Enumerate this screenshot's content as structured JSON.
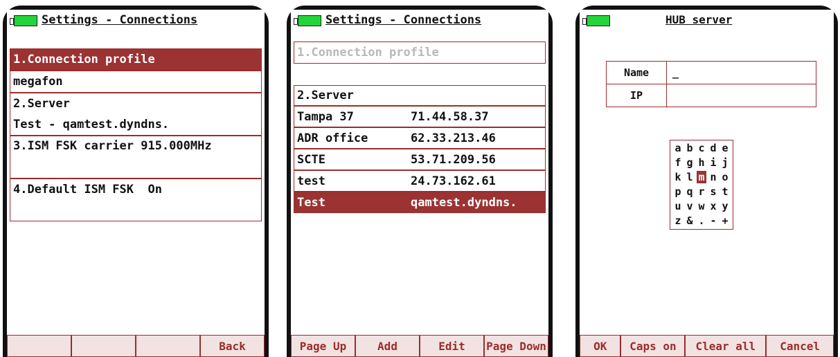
{
  "screens": [
    {
      "title": "Settings - Connections",
      "rows": [
        "1.Connection profile",
        "megafon",
        "2.Server",
        "Test - qamtest.dyndns.",
        "3.ISM FSK carrier 915.000MHz",
        "4.Default ISM FSK  On"
      ],
      "footer": [
        "",
        "",
        "",
        "Back"
      ]
    },
    {
      "title": "Settings - Connections",
      "header_row": "1.Connection profile",
      "server_label": "2.Server",
      "servers": [
        {
          "name": "Tampa 37",
          "address": "71.44.58.37"
        },
        {
          "name": "ADR office",
          "address": "62.33.213.46"
        },
        {
          "name": "SCTE",
          "address": "53.71.209.56"
        },
        {
          "name": "test",
          "address": "24.73.162.61"
        },
        {
          "name": "Test",
          "address": "qamtest.dyndns."
        }
      ],
      "footer": [
        "Page Up",
        "Add",
        "Edit",
        "Page Down"
      ]
    },
    {
      "title": "HUB server",
      "fields": [
        {
          "label": "Name",
          "value": "_"
        },
        {
          "label": "IP",
          "value": ""
        }
      ],
      "keyboard_rows": [
        [
          "a",
          "b",
          "c",
          "d",
          "e"
        ],
        [
          "f",
          "g",
          "h",
          "i",
          "j"
        ],
        [
          "k",
          "l",
          "m",
          "n",
          "o"
        ],
        [
          "p",
          "q",
          "r",
          "s",
          "t"
        ],
        [
          "u",
          "v",
          "w",
          "x",
          "y"
        ],
        [
          "z",
          "&",
          ".",
          "-",
          "+"
        ]
      ],
      "active_key": "m",
      "footer": [
        "OK",
        "Caps on",
        "Clear all",
        "Cancel"
      ]
    }
  ],
  "colors": {
    "accent": "#9b3333",
    "battery": "#24d43a"
  }
}
